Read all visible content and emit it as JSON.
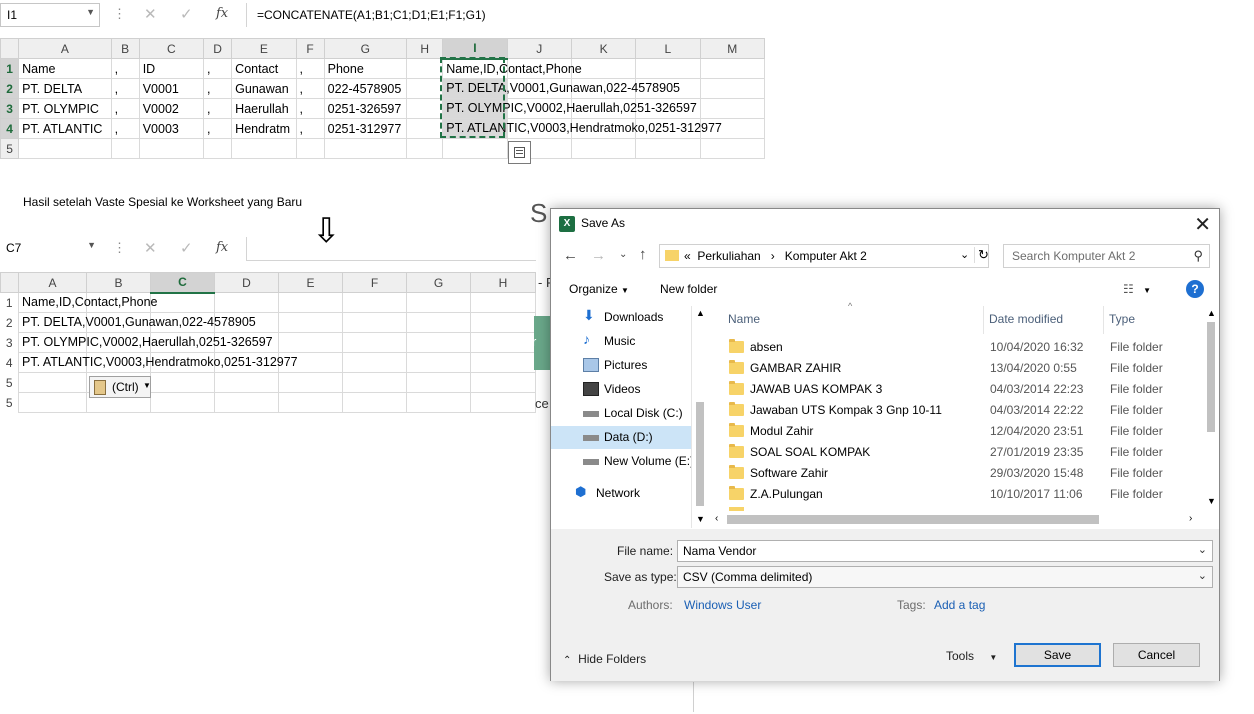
{
  "top_sheet": {
    "name_box": "I1",
    "formula": "=CONCATENATE(A1;B1;C1;D1;E1;F1;G1)",
    "columns": [
      "A",
      "B",
      "C",
      "D",
      "E",
      "F",
      "G",
      "H",
      "I",
      "J",
      "K",
      "L",
      "M"
    ],
    "rows": [
      {
        "num": "1",
        "cells": [
          "Name",
          ",",
          "ID",
          ",",
          "Contact",
          ",",
          "Phone",
          "",
          "Name,ID,Contact,Phone"
        ]
      },
      {
        "num": "2",
        "cells": [
          "PT. DELTA",
          ",",
          "V0001",
          ",",
          "Gunawan",
          ",",
          "022-4578905",
          "",
          "PT. DELTA,V0001,Gunawan,022-4578905"
        ]
      },
      {
        "num": "3",
        "cells": [
          "PT. OLYMPIC",
          ",",
          "V0002",
          ",",
          "Haerullah",
          ",",
          "0251-326597",
          "",
          "PT. OLYMPIC,V0002,Haerullah,0251-326597"
        ]
      },
      {
        "num": "4",
        "cells": [
          "PT. ATLANTIC",
          ",",
          "V0003",
          ",",
          "Hendratm",
          ",",
          "0251-312977",
          "",
          "PT. ATLANTIC,V0003,Hendratmoko,0251-312977"
        ]
      },
      {
        "num": "5",
        "cells": [
          "",
          "",
          "",
          "",
          "",
          "",
          "",
          "",
          ""
        ]
      }
    ]
  },
  "caption": "Hasil setelah Vaste Spesial ke Worksheet yang Baru",
  "arrow": "⇩",
  "bottom_sheet": {
    "name_box": "C7",
    "columns": [
      "A",
      "B",
      "C",
      "D",
      "E",
      "F",
      "G",
      "H"
    ],
    "rows": [
      {
        "num": "1",
        "value": "Name,ID,Contact,Phone"
      },
      {
        "num": "2",
        "value": "PT. DELTA,V0001,Gunawan,022-4578905"
      },
      {
        "num": "3",
        "value": "PT. OLYMPIC,V0002,Haerullah,0251-326597"
      },
      {
        "num": "4",
        "value": "PT. ATLANTIC,V0003,Hendratmoko,0251-312977"
      },
      {
        "num": "5",
        "value": ""
      },
      {
        "num": "5",
        "value": ""
      }
    ],
    "paste_options": "(Ctrl)"
  },
  "background_fragments": {
    "s_letter": "S",
    "dash_f": "- F",
    "r_letter": "r",
    "ce": "ce"
  },
  "dialog": {
    "title": "Save As",
    "app_icon": "X",
    "breadcrumb": [
      "«",
      "Perkuliahan",
      "›",
      "Komputer Akt 2"
    ],
    "search_placeholder": "Search Komputer Akt 2",
    "toolbar": {
      "organize": "Organize",
      "new_folder": "New folder"
    },
    "nav_items": [
      {
        "label": "Downloads",
        "icon": "downloads-icon"
      },
      {
        "label": "Music",
        "icon": "music-icon"
      },
      {
        "label": "Pictures",
        "icon": "pictures-icon"
      },
      {
        "label": "Videos",
        "icon": "videos-icon"
      },
      {
        "label": "Local Disk (C:)",
        "icon": "drive-icon"
      },
      {
        "label": "Data (D:)",
        "icon": "drive-icon"
      },
      {
        "label": "New Volume (E:)",
        "icon": "drive-icon"
      },
      {
        "label": "Network",
        "icon": "network-icon"
      }
    ],
    "columns": {
      "name": "Name",
      "date": "Date modified",
      "type": "Type"
    },
    "files": [
      {
        "name": "absen",
        "date": "10/04/2020 16:32",
        "type": "File folder"
      },
      {
        "name": "GAMBAR ZAHIR",
        "date": "13/04/2020 0:55",
        "type": "File folder"
      },
      {
        "name": "JAWAB UAS KOMPAK 3",
        "date": "04/03/2014 22:23",
        "type": "File folder"
      },
      {
        "name": "Jawaban UTS Kompak 3 Gnp 10-11",
        "date": "04/03/2014 22:22",
        "type": "File folder"
      },
      {
        "name": "Modul Zahir",
        "date": "12/04/2020 23:51",
        "type": "File folder"
      },
      {
        "name": "SOAL SOAL KOMPAK",
        "date": "27/01/2019 23:35",
        "type": "File folder"
      },
      {
        "name": "Software Zahir",
        "date": "29/03/2020 15:48",
        "type": "File folder"
      },
      {
        "name": "Z.A.Pulungan",
        "date": "10/10/2017 11:06",
        "type": "File folder"
      }
    ],
    "file_name_label": "File name:",
    "file_name_value": "Nama Vendor",
    "save_type_label": "Save as type:",
    "save_type_value": "CSV (Comma delimited)",
    "authors_label": "Authors:",
    "authors_value": "Windows User",
    "tags_label": "Tags:",
    "tags_value": "Add a tag",
    "hide_folders": "Hide Folders",
    "tools": "Tools",
    "save": "Save",
    "cancel": "Cancel"
  }
}
